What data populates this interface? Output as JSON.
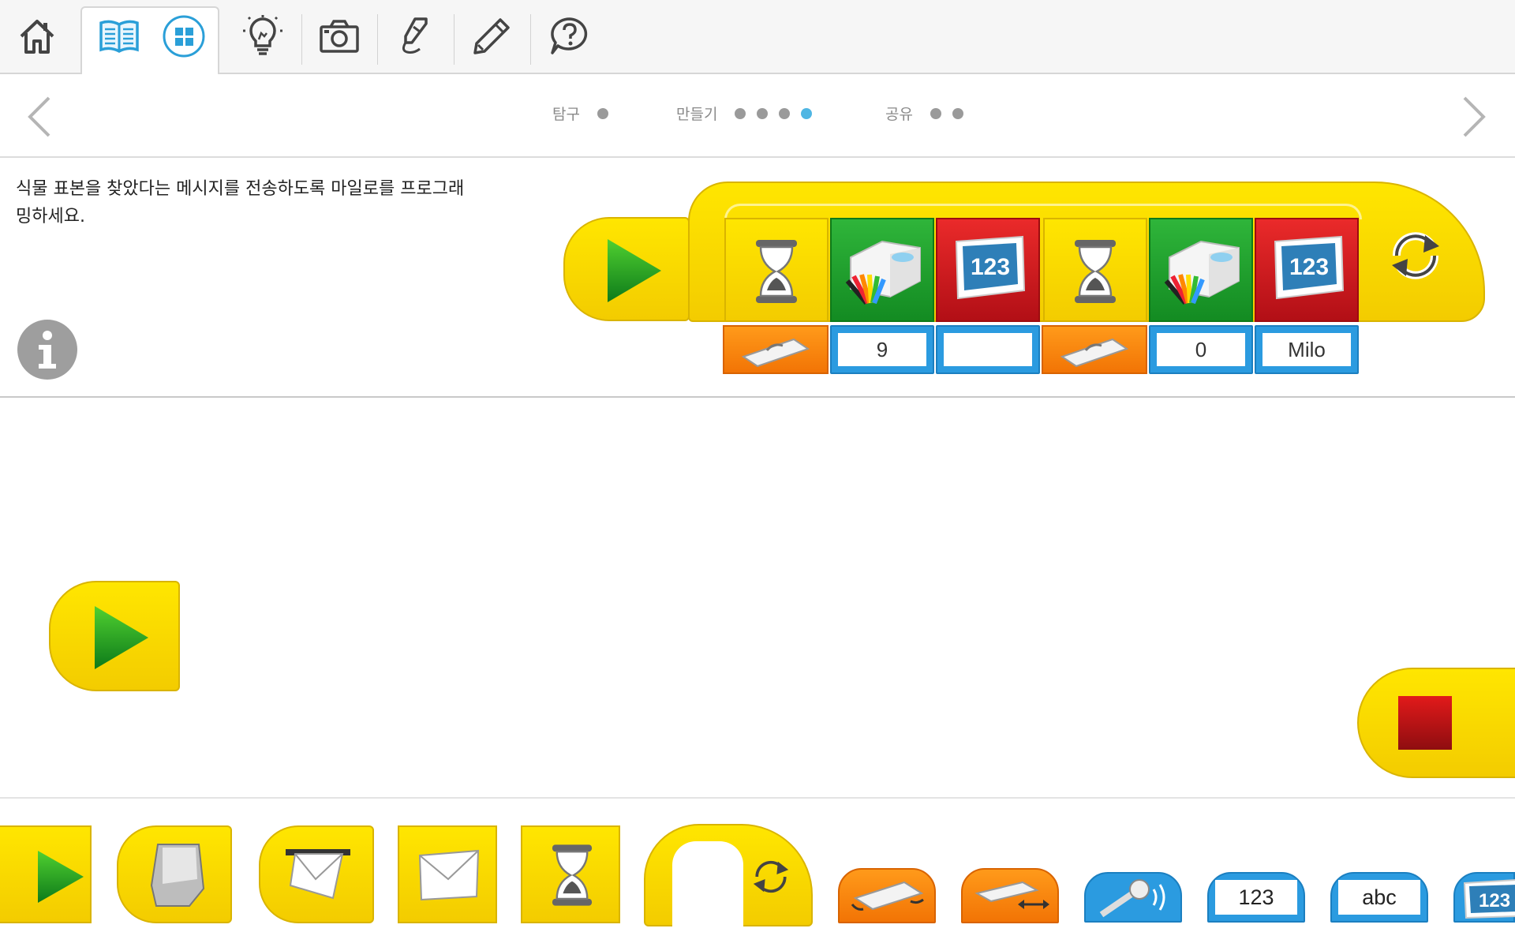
{
  "nav": {
    "phases": [
      {
        "label": "탐구",
        "dots": 1,
        "active_dot": -1
      },
      {
        "label": "만들기",
        "dots": 4,
        "active_dot": 3
      },
      {
        "label": "공유",
        "dots": 2,
        "active_dot": -1
      }
    ]
  },
  "instructions": {
    "text_line1": "식물 표본을 찾았다는 메시지를 전송하도록 마일로를 프로그래",
    "text_line2": "밍하세요."
  },
  "program": {
    "inputs": [
      "9",
      "",
      "0",
      "Milo"
    ]
  },
  "palette": {
    "number_label": "123",
    "text_label": "abc",
    "display_partial": "123"
  },
  "icons": {
    "toolbar": [
      "home-icon",
      "book-icon",
      "grid-icon",
      "lightbulb-icon",
      "camera-icon",
      "microphone-pen-icon",
      "pencil-icon",
      "help-icon"
    ]
  },
  "colors": {
    "yellow": "#ffe600",
    "green": "#1e9e2c",
    "red": "#d21b22",
    "blue": "#2b9be0",
    "orange": "#f68a0f",
    "active_dot": "#4fb6e3"
  }
}
